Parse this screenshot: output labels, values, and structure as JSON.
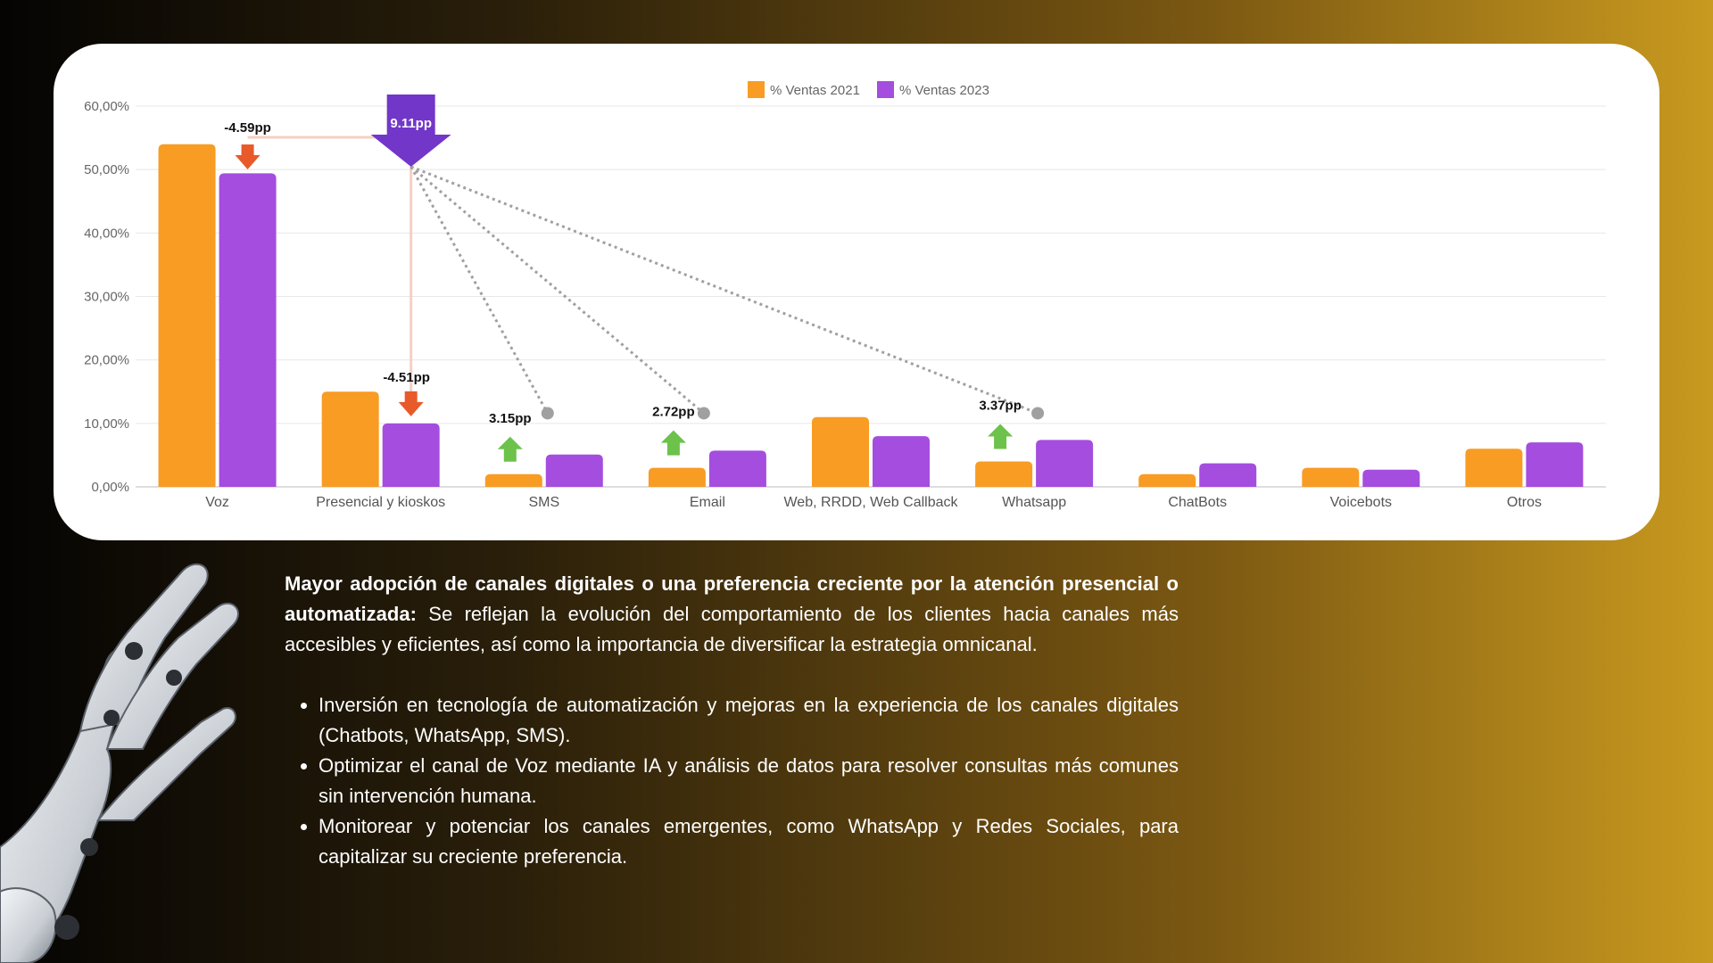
{
  "chart_data": {
    "type": "bar",
    "categories": [
      "Voz",
      "Presencial y kioskos",
      "SMS",
      "Email",
      "Web, RRDD, Web Callback",
      "Whatsapp",
      "ChatBots",
      "Voicebots",
      "Otros"
    ],
    "series": [
      {
        "name": "% Ventas 2021",
        "color": "#f89c24",
        "values": [
          54.0,
          15.0,
          2.0,
          3.0,
          11.0,
          4.0,
          2.0,
          3.0,
          6.0
        ]
      },
      {
        "name": "% Ventas 2023",
        "color": "#a54ddf",
        "values": [
          49.4,
          10.0,
          5.1,
          5.7,
          8.0,
          7.4,
          3.7,
          2.7,
          7.0
        ]
      }
    ],
    "yticks": [
      "0,00%",
      "10,00%",
      "20,00%",
      "30,00%",
      "40,00%",
      "50,00%",
      "60,00%"
    ],
    "ylim": [
      0,
      60
    ],
    "grid": true,
    "legend_position": "top-center",
    "annotations": [
      {
        "category": "Voz",
        "text": "-4.59pp",
        "direction": "down",
        "color": "#e85a2a"
      },
      {
        "category": "Presencial y kioskos",
        "text": "-4.51pp",
        "direction": "down",
        "color": "#e85a2a"
      },
      {
        "category": "SMS",
        "text": "3.15pp",
        "direction": "up",
        "color": "#6cc24a"
      },
      {
        "category": "Email",
        "text": "2.72pp",
        "direction": "up",
        "color": "#6cc24a"
      },
      {
        "category": "Whatsapp",
        "text": "3.37pp",
        "direction": "up",
        "color": "#6cc24a"
      }
    ],
    "callout": {
      "text": "9.11pp",
      "color": "#7236c9"
    }
  },
  "text": {
    "heading_bold": "Mayor adopción de canales digitales o una preferencia creciente por la atención presencial o automatizada:",
    "heading_rest": " Se reflejan la evolución del comportamiento de los clientes hacia canales más accesibles y eficientes, así como la importancia de diversificar la estrategia omnicanal.",
    "bullets": [
      "Inversión en tecnología de automatización y mejoras en la experiencia de los canales digitales (Chatbots, WhatsApp, SMS).",
      "Optimizar el canal de Voz mediante IA y análisis de datos para resolver consultas más comunes sin intervención humana.",
      "Monitorear y potenciar los canales emergentes, como WhatsApp y Redes Sociales, para capitalizar su creciente preferencia."
    ]
  },
  "decor": {
    "hand_icon": "robot-hand-icon"
  }
}
